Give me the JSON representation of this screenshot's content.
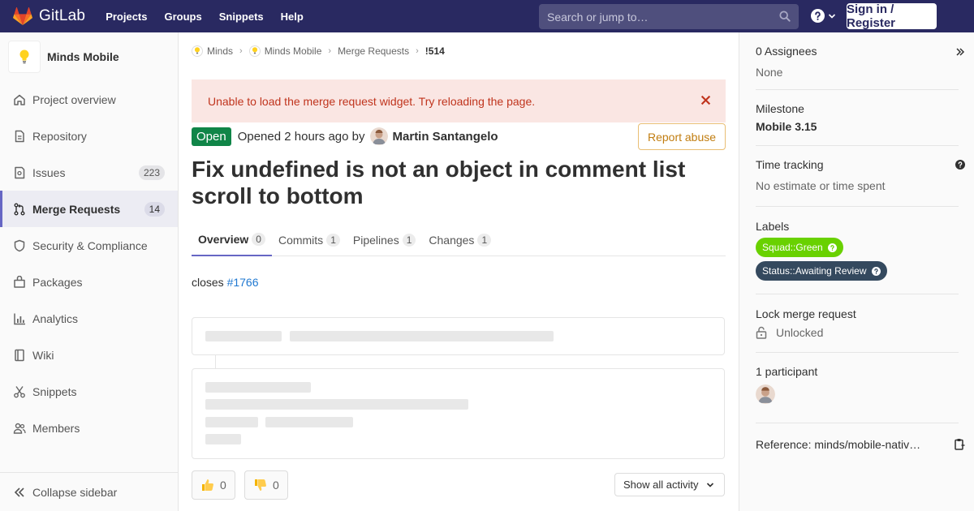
{
  "navbar": {
    "brand": "GitLab",
    "links": [
      "Projects",
      "Groups",
      "Snippets",
      "Help"
    ],
    "search_placeholder": "Search or jump to…",
    "signin": "Sign in / Register"
  },
  "sidebar": {
    "project_name": "Minds Mobile",
    "items": [
      {
        "label": "Project overview",
        "icon": "home-icon"
      },
      {
        "label": "Repository",
        "icon": "doc-icon"
      },
      {
        "label": "Issues",
        "icon": "issues-icon",
        "count": "223"
      },
      {
        "label": "Merge Requests",
        "icon": "merge-request-icon",
        "count": "14",
        "active": true
      },
      {
        "label": "Security & Compliance",
        "icon": "shield-icon"
      },
      {
        "label": "Packages",
        "icon": "package-icon"
      },
      {
        "label": "Analytics",
        "icon": "chart-icon"
      },
      {
        "label": "Wiki",
        "icon": "book-icon"
      },
      {
        "label": "Snippets",
        "icon": "scissors-icon"
      },
      {
        "label": "Members",
        "icon": "users-icon"
      }
    ],
    "collapse": "Collapse sidebar"
  },
  "breadcrumb": [
    "Minds",
    "Minds Mobile",
    "Merge Requests",
    "!514"
  ],
  "alert": "Unable to load the merge request widget. Try reloading the page.",
  "mr": {
    "status": "Open",
    "opened_prefix": "Opened",
    "opened_time": "2 hours ago",
    "by": "by",
    "author": "Martin Santangelo",
    "report": "Report abuse",
    "title": "Fix undefined is not an object in comment list scroll to bottom",
    "description_prefix": "closes",
    "description_link": "#1766"
  },
  "tabs": [
    {
      "label": "Overview",
      "count": "0",
      "active": true
    },
    {
      "label": "Commits",
      "count": "1"
    },
    {
      "label": "Pipelines",
      "count": "1"
    },
    {
      "label": "Changes",
      "count": "1"
    }
  ],
  "awards": [
    {
      "icon": "thumbs-up-icon",
      "count": "0"
    },
    {
      "icon": "thumbs-down-icon",
      "count": "0"
    }
  ],
  "activity_filter": "Show all activity",
  "right_sidebar": {
    "assignees_title": "0 Assignees",
    "assignees_value": "None",
    "milestone_title": "Milestone",
    "milestone_value": "Mobile 3.15",
    "time_title": "Time tracking",
    "time_value": "No estimate or time spent",
    "labels_title": "Labels",
    "labels": [
      {
        "text": "Squad::Green",
        "color": "#69d100"
      },
      {
        "text": "Status::Awaiting Review",
        "color": "#34495e"
      }
    ],
    "lock_title": "Lock merge request",
    "lock_value": "Unlocked",
    "participants_title": "1 participant",
    "reference": "Reference: minds/mobile-nativ…"
  },
  "colors": {
    "navbar": "#292961",
    "accent": "#6666c4",
    "open": "#108548",
    "alert_bg": "#fae6e3",
    "alert_text": "#c0341d",
    "link": "#1f78d1"
  }
}
